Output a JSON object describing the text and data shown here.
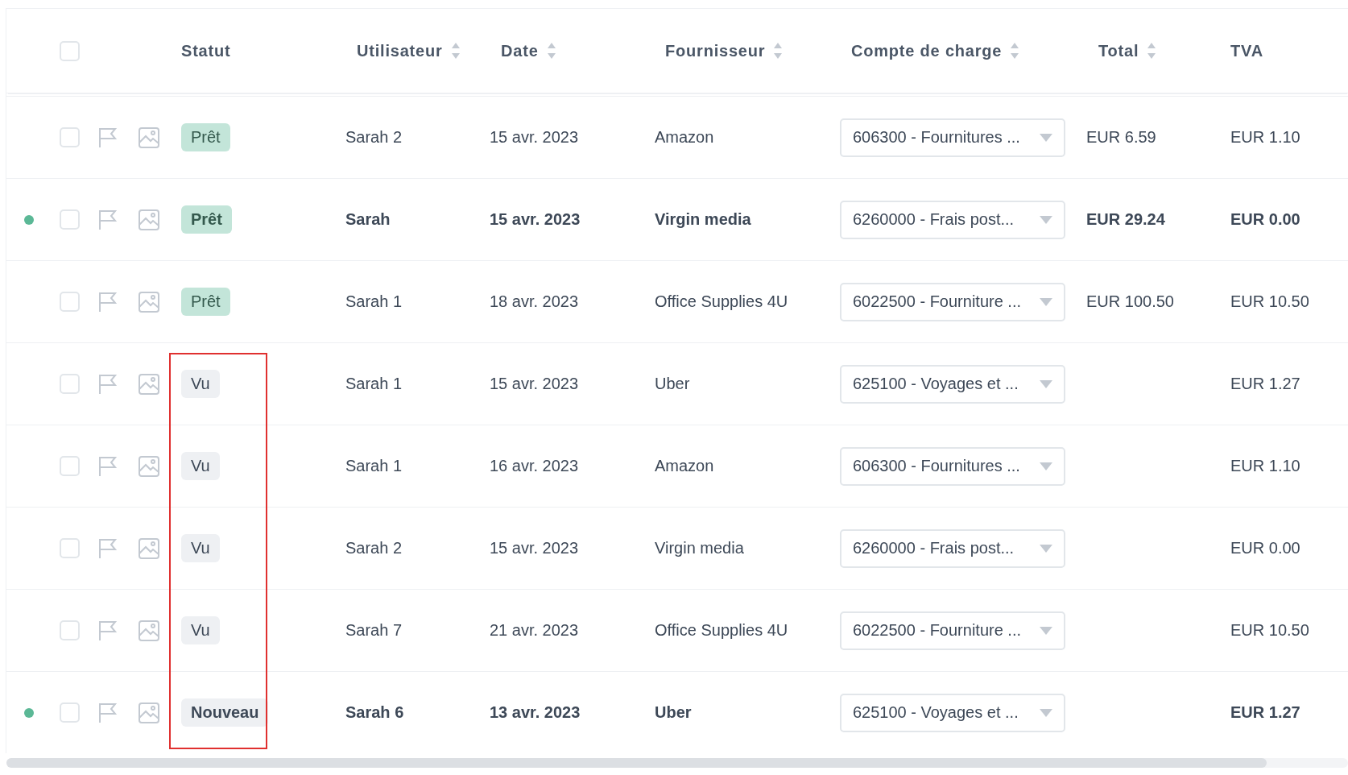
{
  "table": {
    "select_all": {
      "checked": false
    },
    "columns": [
      {
        "label": "Statut",
        "sortable": false
      },
      {
        "label": "Utilisateur",
        "sortable": true
      },
      {
        "label": "Date",
        "sortable": true
      },
      {
        "label": "Fournisseur",
        "sortable": true
      },
      {
        "label": "Compte de charge",
        "sortable": true
      },
      {
        "label": "Total",
        "sortable": true
      },
      {
        "label": "TVA",
        "sortable": false
      }
    ],
    "rows": [
      {
        "unread": false,
        "checked": false,
        "highlighted": false,
        "status": {
          "label": "Prêt",
          "kind": "ready"
        },
        "user": "Sarah 2",
        "date": "15 avr. 2023",
        "supplier": "Amazon",
        "account": "606300 - Fournitures ...",
        "total": "EUR 6.59",
        "vat": "EUR 1.10"
      },
      {
        "unread": true,
        "checked": false,
        "highlighted": false,
        "status": {
          "label": "Prêt",
          "kind": "ready"
        },
        "user": "Sarah",
        "date": "15 avr. 2023",
        "supplier": "Virgin media",
        "account": "6260000 - Frais post...",
        "total": "EUR 29.24",
        "vat": "EUR 0.00"
      },
      {
        "unread": false,
        "checked": false,
        "highlighted": false,
        "status": {
          "label": "Prêt",
          "kind": "ready"
        },
        "user": "Sarah 1",
        "date": "18 avr. 2023",
        "supplier": "Office Supplies 4U",
        "account": "6022500 - Fourniture ...",
        "total": "EUR 100.50",
        "vat": "EUR 10.50"
      },
      {
        "unread": false,
        "checked": false,
        "highlighted": true,
        "status": {
          "label": "Vu",
          "kind": "seen"
        },
        "user": "Sarah 1",
        "date": "15 avr. 2023",
        "supplier": "Uber",
        "account": "625100 - Voyages et ...",
        "vat": "EUR 1.27"
      },
      {
        "unread": false,
        "checked": false,
        "highlighted": true,
        "status": {
          "label": "Vu",
          "kind": "seen"
        },
        "user": "Sarah 1",
        "date": "16 avr. 2023",
        "supplier": "Amazon",
        "account": "606300 - Fournitures ...",
        "vat": "EUR 1.10"
      },
      {
        "unread": false,
        "checked": false,
        "highlighted": true,
        "status": {
          "label": "Vu",
          "kind": "seen"
        },
        "user": "Sarah 2",
        "date": "15 avr. 2023",
        "supplier": "Virgin media",
        "account": "6260000 - Frais post...",
        "vat": "EUR 0.00"
      },
      {
        "unread": false,
        "checked": false,
        "highlighted": true,
        "status": {
          "label": "Vu",
          "kind": "seen"
        },
        "user": "Sarah 7",
        "date": "21 avr. 2023",
        "supplier": "Office Supplies 4U",
        "account": "6022500 - Fourniture ...",
        "vat": "EUR 10.50"
      },
      {
        "unread": true,
        "checked": false,
        "highlighted": true,
        "status": {
          "label": "Nouveau",
          "kind": "new"
        },
        "user": "Sarah 6",
        "date": "13 avr. 2023",
        "supplier": "Uber",
        "account": "625100 - Voyages et ...",
        "vat": "EUR 1.27"
      }
    ]
  }
}
